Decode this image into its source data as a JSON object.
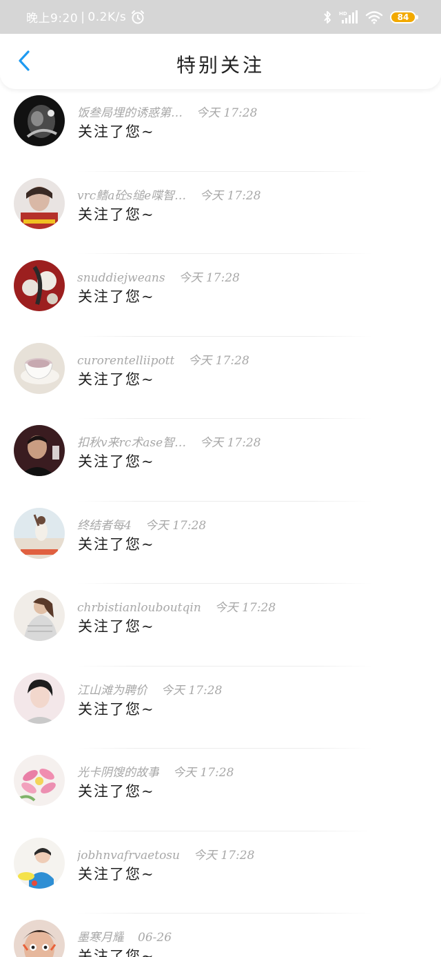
{
  "status_bar": {
    "time": "晚上9:20",
    "network_speed": "0.2K/s",
    "battery": "84",
    "icons": [
      "alarm-icon",
      "bluetooth-icon",
      "hd-signal-icon",
      "wifi-icon",
      "battery-icon"
    ],
    "battery_color": "#f2a900"
  },
  "nav": {
    "title": "特别关注",
    "back_icon": "chevron-left-icon",
    "accent_color": "#1e9af1"
  },
  "items": [
    {
      "username": "饭叁局埋的诱惑第…",
      "time": "今天 17:28",
      "action": "关注了您~"
    },
    {
      "username": "vrc鳍a砼s缒e喋智…",
      "time": "今天 17:28",
      "action": "关注了您~"
    },
    {
      "username": "snuddiejweans",
      "time": "今天 17:28",
      "action": "关注了您~"
    },
    {
      "username": "curorentelliipott",
      "time": "今天 17:28",
      "action": "关注了您~"
    },
    {
      "username": "扣秋v来rc术ase智…",
      "time": "今天 17:28",
      "action": "关注了您~"
    },
    {
      "username": "终结者每4",
      "time": "今天 17:28",
      "action": "关注了您~"
    },
    {
      "username": "chrbistianlouboutqin",
      "time": "今天 17:28",
      "action": "关注了您~"
    },
    {
      "username": "江山滩为聘价",
      "time": "今天 17:28",
      "action": "关注了您~"
    },
    {
      "username": "光卡阴馊的故事",
      "time": "今天 17:28",
      "action": "关注了您~"
    },
    {
      "username": "jobhnvafrvaetosu",
      "time": "今天 17:28",
      "action": "关注了您~"
    },
    {
      "username": "墨寒月耀",
      "time": "06-26",
      "action": "关注了您~"
    }
  ]
}
